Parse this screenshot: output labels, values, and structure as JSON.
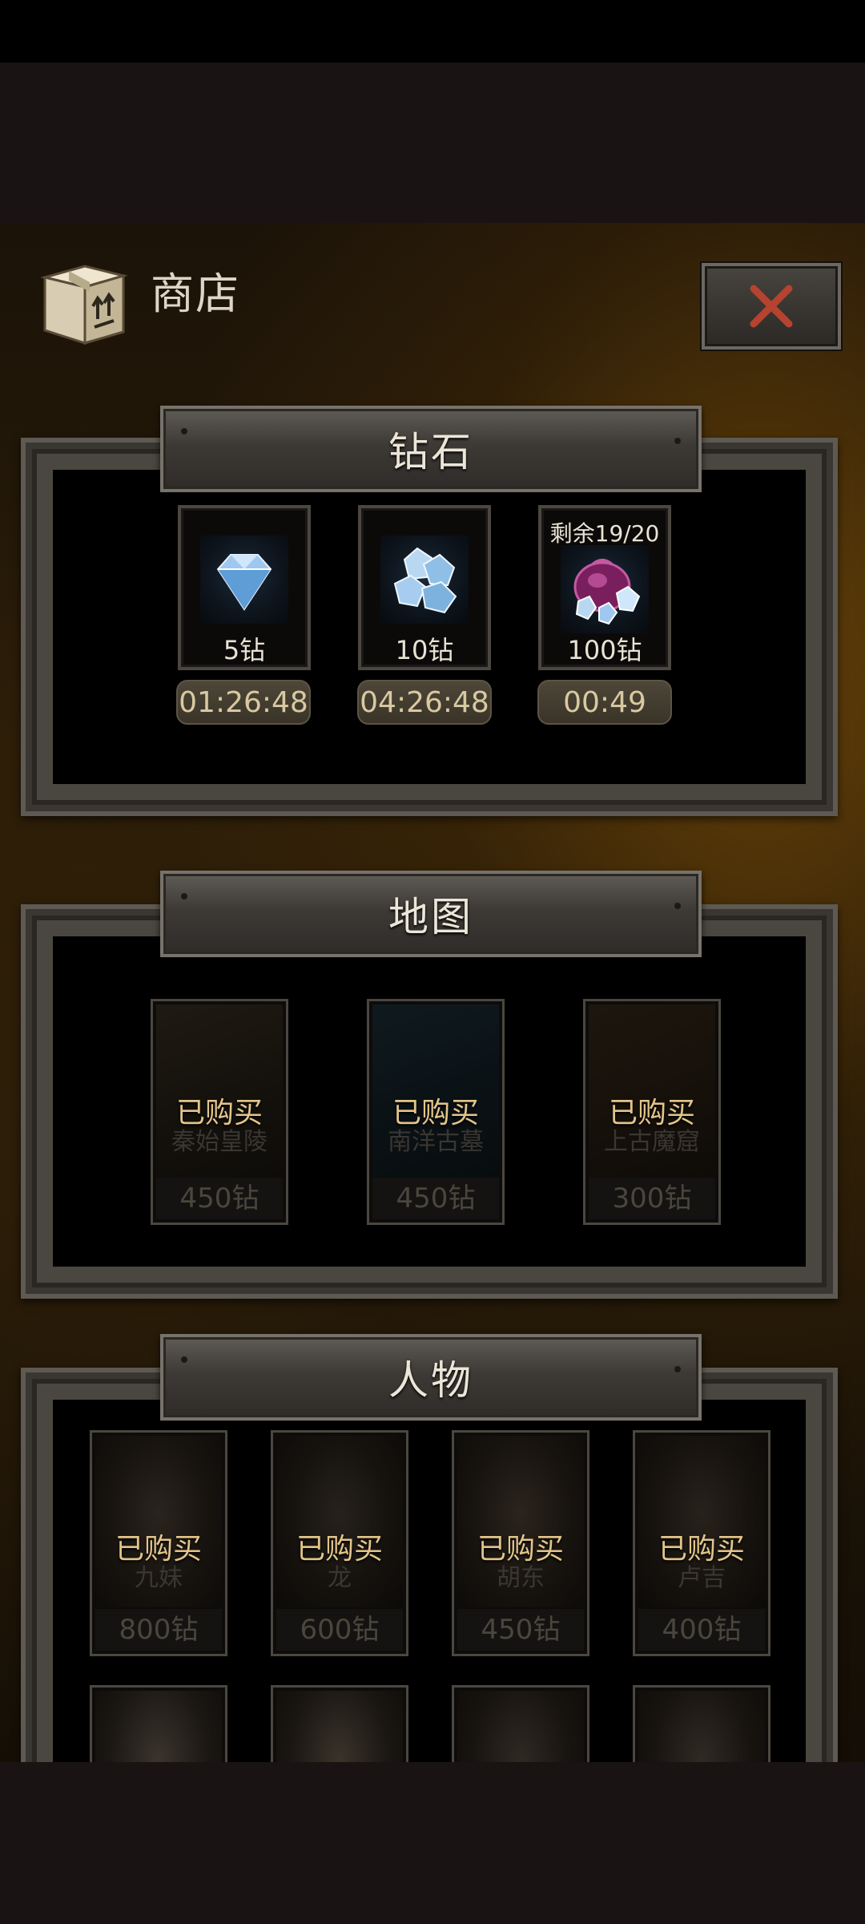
{
  "shop": {
    "title": "商店",
    "close_icon": "close-x-icon",
    "box_icon": "shipping-box-icon",
    "accent_color": "#e3c58a",
    "close_color": "#b5432f"
  },
  "diamond_section": {
    "title": "钻石",
    "items": [
      {
        "amount": "5钻",
        "timer": "01:26:48",
        "remaining": "",
        "icon": "single-diamond-icon"
      },
      {
        "amount": "10钻",
        "timer": "04:26:48",
        "remaining": "",
        "icon": "diamond-pile-icon"
      },
      {
        "amount": "100钻",
        "timer": "00:49",
        "remaining": "剩余19/20",
        "icon": "diamond-bag-icon"
      }
    ]
  },
  "map_section": {
    "title": "地图",
    "items": [
      {
        "name": "秦始皇陵",
        "status": "已购买",
        "price": "450钻"
      },
      {
        "name": "南洋古墓",
        "status": "已购买",
        "price": "450钻"
      },
      {
        "name": "上古魔窟",
        "status": "已购买",
        "price": "300钻"
      }
    ]
  },
  "character_section": {
    "title": "人物",
    "items": [
      {
        "name": "九妹",
        "status": "已购买",
        "price": "800钻"
      },
      {
        "name": "龙",
        "status": "已购买",
        "price": "600钻"
      },
      {
        "name": "胡东",
        "status": "已购买",
        "price": "450钻"
      },
      {
        "name": "卢吉",
        "status": "已购买",
        "price": "400钻"
      }
    ]
  }
}
